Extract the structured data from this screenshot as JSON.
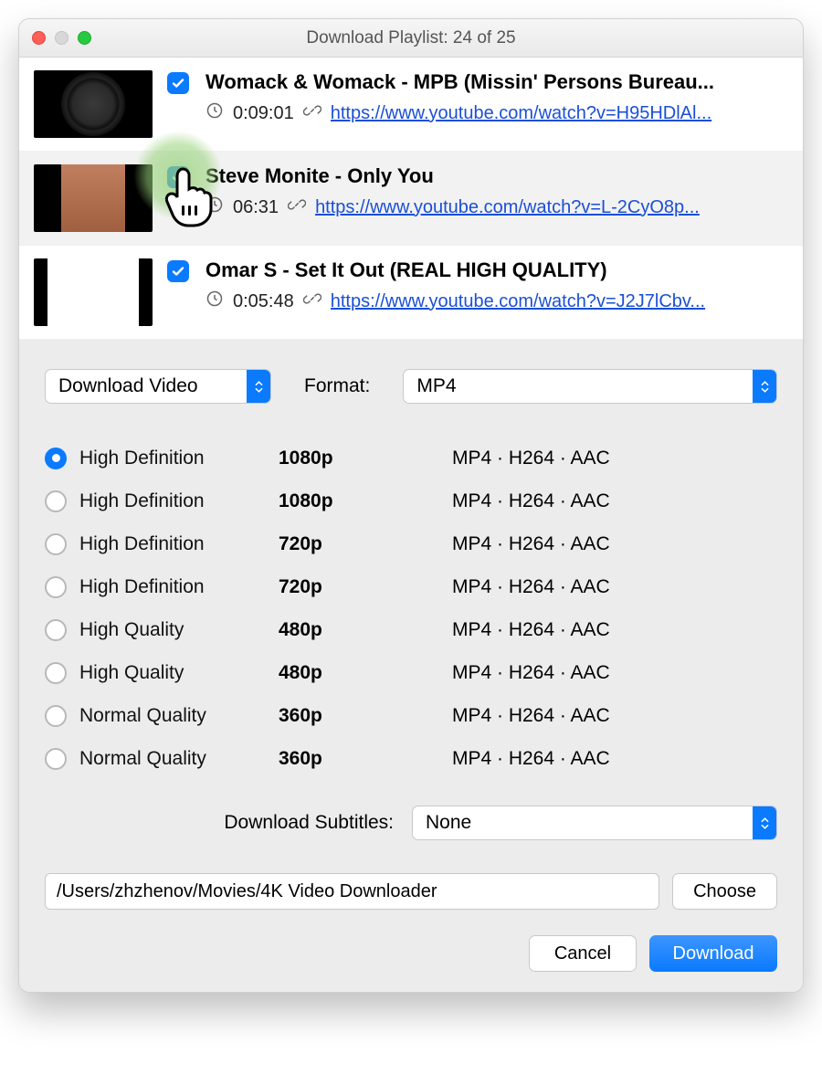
{
  "window": {
    "title": "Download Playlist: 24 of 25"
  },
  "items": [
    {
      "title": "Womack & Womack - MPB (Missin' Persons Bureau...",
      "duration": "0:09:01",
      "url": "https://www.youtube.com/watch?v=H95HDlAl...",
      "checked": true,
      "thumb": "circle"
    },
    {
      "title": "Steve Monite - Only You",
      "duration": "06:31",
      "url": "https://www.youtube.com/watch?v=L-2CyO8p...",
      "checked": true,
      "thumb": "figure",
      "highlight": true
    },
    {
      "title": "Omar S - Set It Out (REAL HIGH QUALITY)",
      "duration": "0:05:48",
      "url": "https://www.youtube.com/watch?v=J2J7lCbv...",
      "checked": true,
      "thumb": "white"
    }
  ],
  "controls": {
    "action": "Download Video",
    "format_label": "Format:",
    "format_value": "MP4",
    "subtitles_label": "Download Subtitles:",
    "subtitles_value": "None",
    "path": "/Users/zhzhenov/Movies/4K Video Downloader",
    "choose": "Choose",
    "cancel": "Cancel",
    "download": "Download"
  },
  "quality": [
    {
      "name": "High Definition",
      "res": "1080p",
      "codec": "MP4 · H264 · AAC",
      "selected": true
    },
    {
      "name": "High Definition",
      "res": "1080p",
      "codec": "MP4 · H264 · AAC",
      "selected": false
    },
    {
      "name": "High Definition",
      "res": "720p",
      "codec": "MP4 · H264 · AAC",
      "selected": false
    },
    {
      "name": "High Definition",
      "res": "720p",
      "codec": "MP4 · H264 · AAC",
      "selected": false
    },
    {
      "name": "High Quality",
      "res": "480p",
      "codec": "MP4 · H264 · AAC",
      "selected": false
    },
    {
      "name": "High Quality",
      "res": "480p",
      "codec": "MP4 · H264 · AAC",
      "selected": false
    },
    {
      "name": "Normal Quality",
      "res": "360p",
      "codec": "MP4 · H264 · AAC",
      "selected": false
    },
    {
      "name": "Normal Quality",
      "res": "360p",
      "codec": "MP4 · H264 · AAC",
      "selected": false
    }
  ]
}
